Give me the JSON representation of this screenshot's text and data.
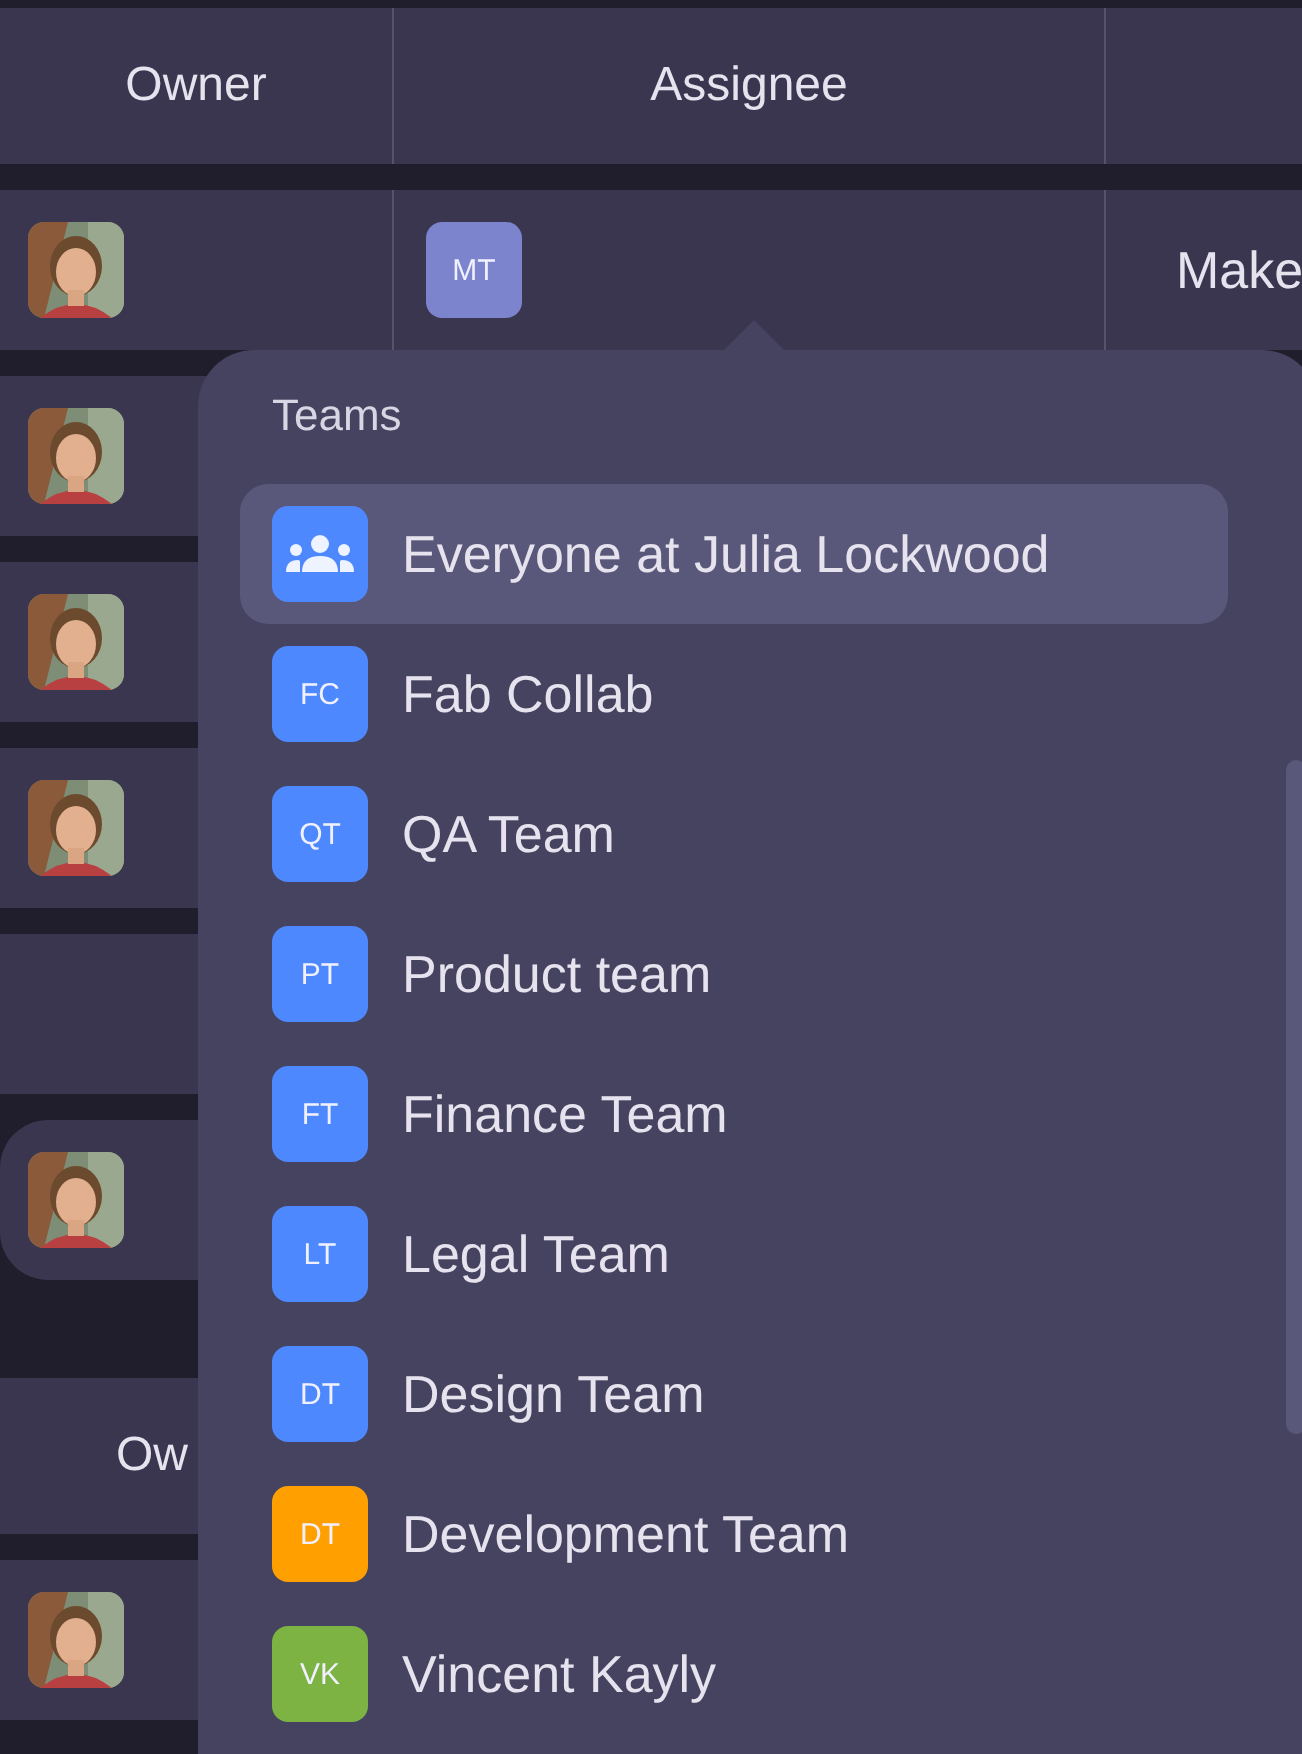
{
  "table": {
    "columns": [
      "Owner",
      "Assignee"
    ],
    "rows": [
      {
        "kind": "row",
        "assignee": "MT",
        "column_3": "Make"
      },
      {
        "kind": "row"
      },
      {
        "kind": "row"
      },
      {
        "kind": "row"
      },
      {
        "kind": "empty"
      },
      {
        "kind": "card"
      },
      {
        "kind": "header",
        "label": "Ow"
      },
      {
        "kind": "row"
      }
    ]
  },
  "dropdown": {
    "title": "Teams",
    "items": [
      {
        "kind": "group",
        "name": "Everyone at Julia Lockwood",
        "color": "#4d88ff",
        "selected": true
      },
      {
        "kind": "initials",
        "initials": "FC",
        "name": "Fab Collab",
        "color": "#4d88ff",
        "selected": false
      },
      {
        "kind": "initials",
        "initials": "QT",
        "name": "QA Team",
        "color": "#4d88ff",
        "selected": false
      },
      {
        "kind": "initials",
        "initials": "PT",
        "name": "Product team",
        "color": "#4d88ff",
        "selected": false
      },
      {
        "kind": "initials",
        "initials": "FT",
        "name": "Finance Team",
        "color": "#4d88ff",
        "selected": false
      },
      {
        "kind": "initials",
        "initials": "LT",
        "name": "Legal Team",
        "color": "#4d88ff",
        "selected": false
      },
      {
        "kind": "initials",
        "initials": "DT",
        "name": "Design Team",
        "color": "#4d88ff",
        "selected": false
      },
      {
        "kind": "initials",
        "initials": "DT",
        "name": "Development Team",
        "color": "#ffa000",
        "selected": false
      },
      {
        "kind": "initials",
        "initials": "VK",
        "name": "Vincent Kayly",
        "color": "#7cb342",
        "selected": false
      }
    ]
  }
}
